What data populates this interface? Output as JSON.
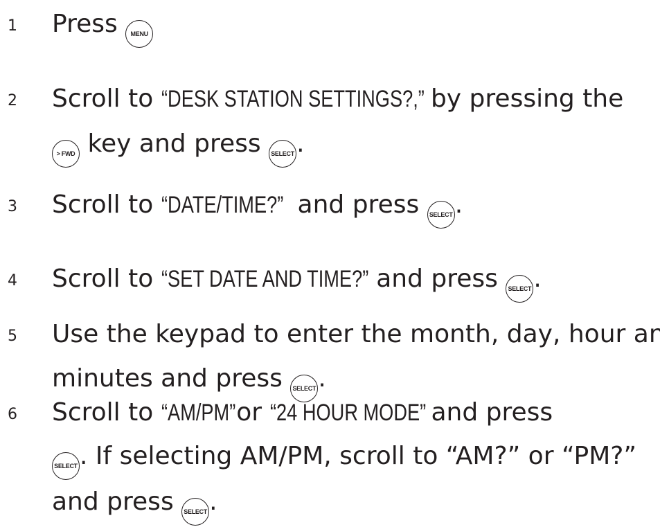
{
  "keys": {
    "menu": "MENU",
    "fwd": "> FWD",
    "select": "SELECT"
  },
  "steps": [
    {
      "number": "1",
      "text_a": "Press"
    },
    {
      "number": "2",
      "text_a": "Scroll to ",
      "quote": "“DESK STATION SETTINGS?,”",
      "text_b": " by pressing the",
      "text_c": "key and press",
      "text_d": "."
    },
    {
      "number": "3",
      "text_a": "Scroll to ",
      "quote": "“DATE/TIME?”",
      "text_b": " and press",
      "text_c": "."
    },
    {
      "number": "4",
      "text_a": "Scroll to ",
      "quote": "“SET DATE AND TIME?”",
      "text_b": " and press",
      "text_c": "."
    },
    {
      "number": "5",
      "text_a": "Use the keypad to enter the month, day, hour and",
      "text_b": "minutes and press",
      "text_c": "."
    },
    {
      "number": "6",
      "text_a": "Scroll to ",
      "quote_a": "“AM/PM”",
      "text_b": " or ",
      "quote_b": "“24 HOUR MODE”",
      "text_c": " and press",
      "text_d": ". If selecting AM/PM, scroll to “AM?” or “PM?”",
      "text_e": "and press",
      "text_f": "."
    }
  ]
}
